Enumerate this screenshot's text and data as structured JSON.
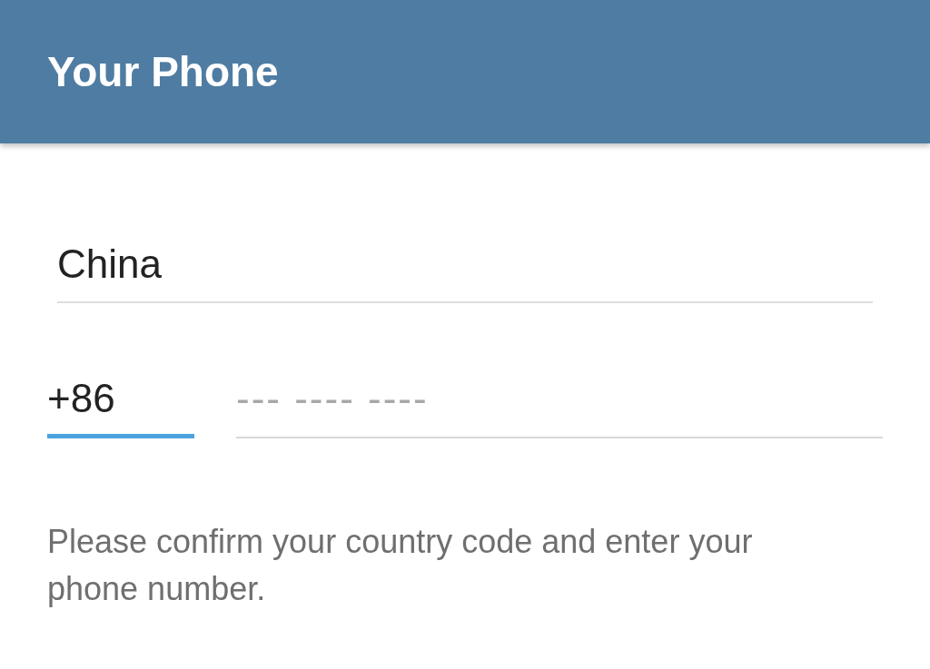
{
  "header": {
    "title": "Your Phone"
  },
  "country": {
    "value": "China"
  },
  "code": {
    "value": "+86",
    "focused": true
  },
  "phone": {
    "placeholder": "--- ---- ----",
    "focused": false
  },
  "hint": "Please confirm your country code and enter your phone number."
}
